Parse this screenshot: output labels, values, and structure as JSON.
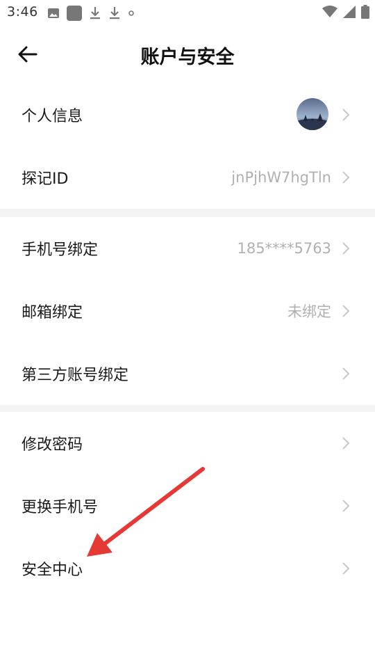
{
  "status_bar": {
    "time": "3:46",
    "left_icons": [
      "image-icon",
      "app-icon",
      "download-icon",
      "download-icon",
      "dot-icon"
    ],
    "right_icons": [
      "wifi-icon",
      "signal-icon",
      "battery-icon"
    ]
  },
  "header": {
    "title": "账户与安全",
    "back_icon": "back-arrow-icon"
  },
  "sections": [
    {
      "rows": [
        {
          "label": "个人信息",
          "value": "",
          "type": "avatar"
        },
        {
          "label": "探记ID",
          "value": "jnPjhW7hgTln",
          "type": "text"
        }
      ]
    },
    {
      "rows": [
        {
          "label": "手机号绑定",
          "value": "185****5763",
          "type": "text"
        },
        {
          "label": "邮箱绑定",
          "value": "未绑定",
          "type": "text"
        },
        {
          "label": "第三方账号绑定",
          "value": "",
          "type": "text"
        }
      ]
    },
    {
      "rows": [
        {
          "label": "修改密码",
          "value": "",
          "type": "text"
        },
        {
          "label": "更换手机号",
          "value": "",
          "type": "text"
        },
        {
          "label": "安全中心",
          "value": "",
          "type": "text"
        }
      ]
    }
  ],
  "annotation": {
    "arrow_color": "#e53935"
  }
}
